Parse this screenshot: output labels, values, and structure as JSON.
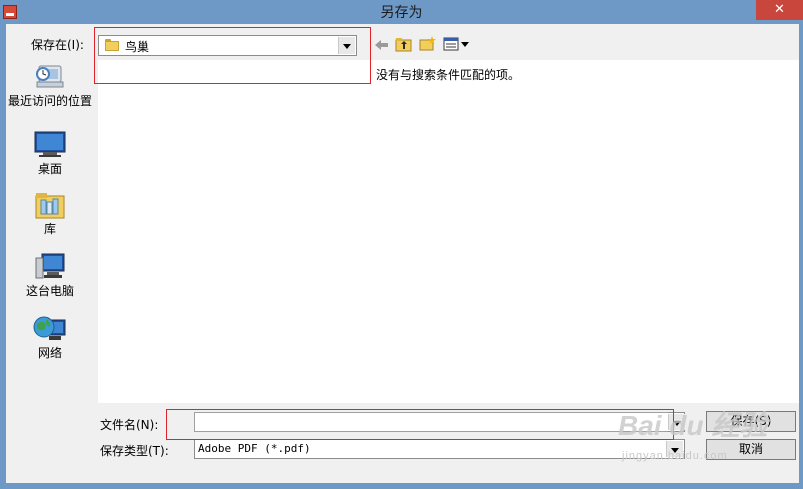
{
  "window": {
    "title": "另存为",
    "close_glyph": "✕"
  },
  "save_in": {
    "label": "保存在(I):",
    "value": "鸟巢"
  },
  "places": [
    {
      "label": "最近访问的位置",
      "icon": "recent-places-icon"
    },
    {
      "label": "桌面",
      "icon": "desktop-icon"
    },
    {
      "label": "库",
      "icon": "libraries-icon"
    },
    {
      "label": "这台电脑",
      "icon": "computer-icon"
    },
    {
      "label": "网络",
      "icon": "network-icon"
    }
  ],
  "file_list": {
    "empty_message": "没有与搜索条件匹配的项。"
  },
  "file_name": {
    "label": "文件名(N):",
    "value": ""
  },
  "file_type": {
    "label": "保存类型(T):",
    "value": "Adobe PDF (*.pdf)"
  },
  "buttons": {
    "save": "保存(S)",
    "cancel": "取消"
  },
  "watermark": {
    "text": "Bai du 经验",
    "sub": "jingyan.baidu.com"
  },
  "colors": {
    "titlebar": "#6e99c6",
    "close": "#c9463d",
    "highlight": "#e0242b"
  }
}
